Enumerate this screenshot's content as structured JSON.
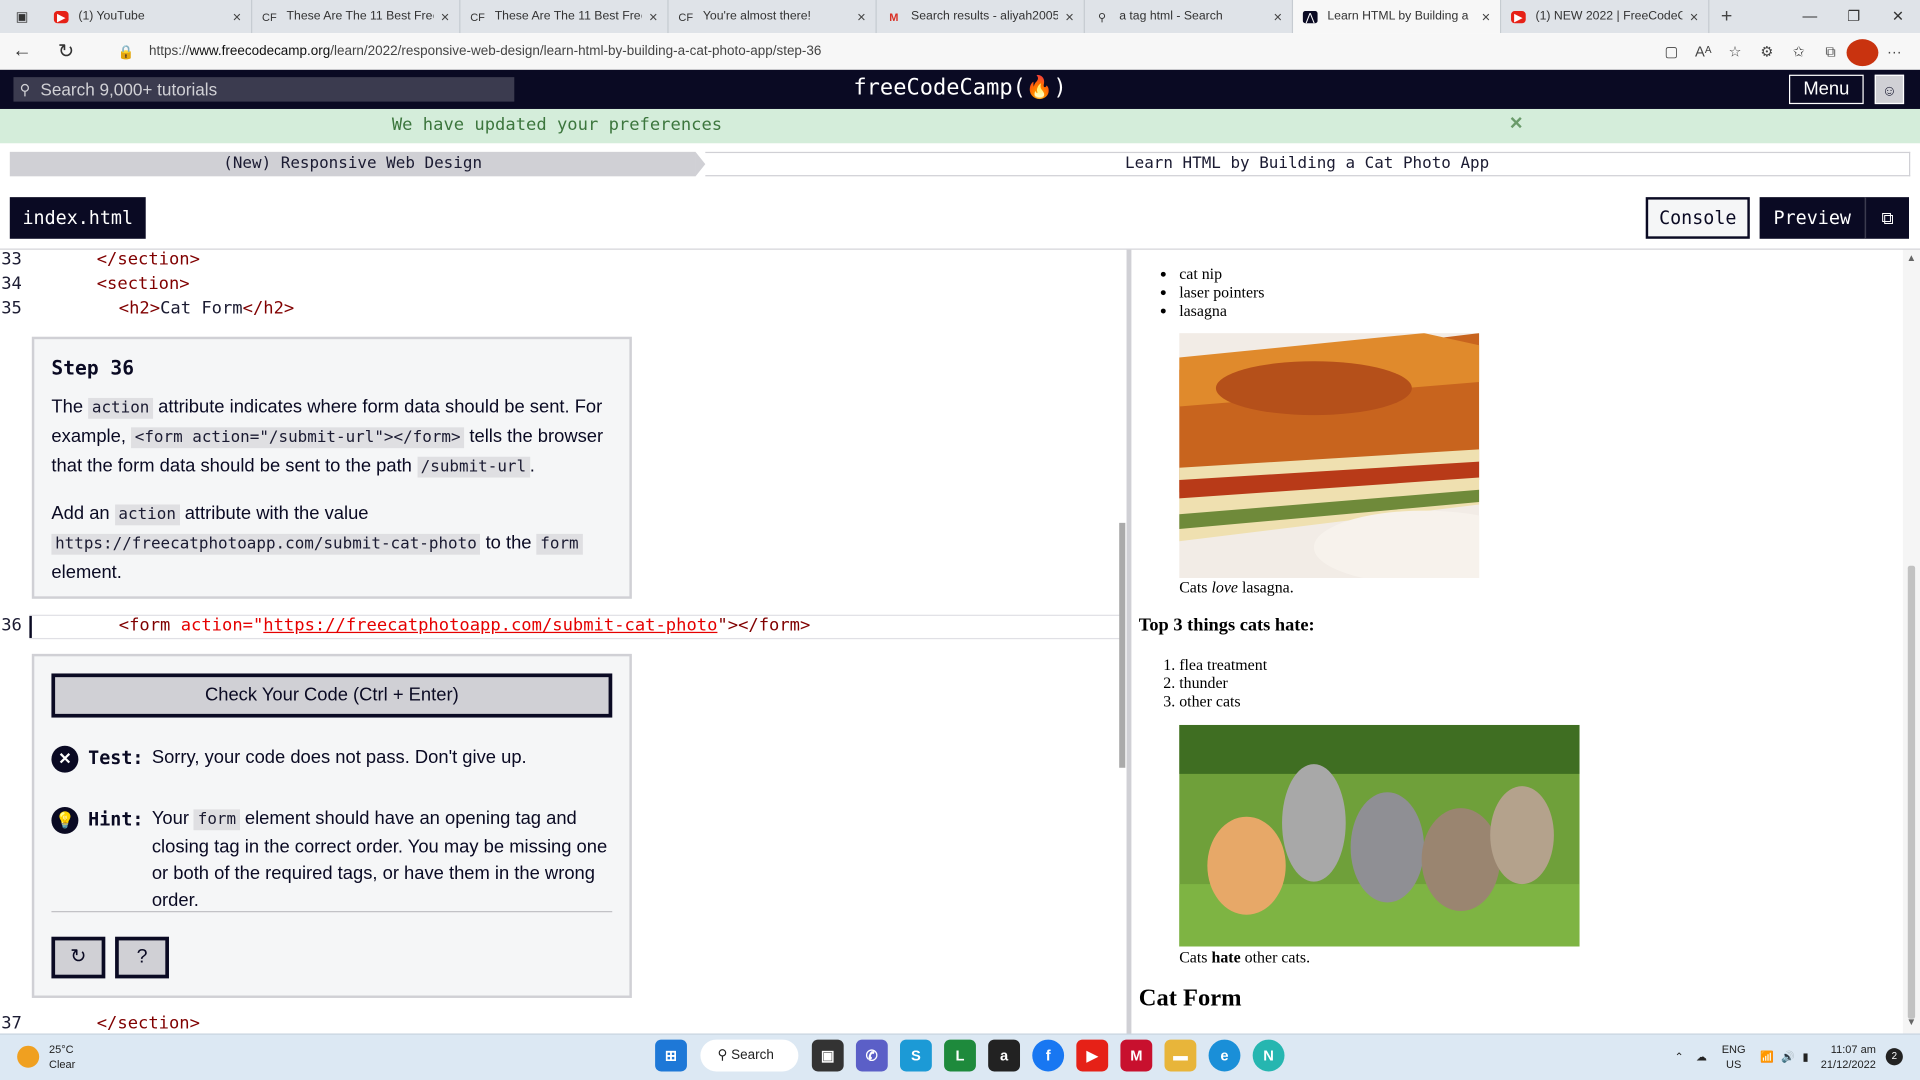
{
  "browser": {
    "tabs": [
      {
        "title": "(1) YouTube",
        "icon": "youtube-icon",
        "active": false
      },
      {
        "title": "These Are The 11 Best Free",
        "icon": "fcc-icon",
        "active": false
      },
      {
        "title": "These Are The 11 Best Free",
        "icon": "fcc-icon",
        "active": false
      },
      {
        "title": "You're almost there!",
        "icon": "fcc-icon",
        "active": false
      },
      {
        "title": "Search results - aliyah2005",
        "icon": "gmail-icon",
        "active": false
      },
      {
        "title": "a tag html - Search",
        "icon": "search-icon",
        "active": false
      },
      {
        "title": "Learn HTML by Building a",
        "icon": "fcc-icon",
        "active": true
      },
      {
        "title": "(1) NEW 2022 | FreeCodeC",
        "icon": "youtube-icon",
        "active": false
      }
    ],
    "url_prefix": "https://",
    "url_host": "www.freecodecamp.org",
    "url_path": "/learn/2022/responsive-web-design/learn-html-by-building-a-cat-photo-app/step-36"
  },
  "fcc": {
    "search_placeholder": "Search 9,000+ tutorials",
    "logo": "freeCodeCamp(🔥)",
    "menu_label": "Menu"
  },
  "flash": {
    "message": "We have updated your preferences",
    "close": "×"
  },
  "breadcrumb": {
    "superblock": "(New) Responsive Web Design",
    "block": "Learn HTML by Building a Cat Photo App"
  },
  "toolbar": {
    "file_tab": "index.html",
    "console": "Console",
    "preview": "Preview"
  },
  "editor": {
    "lines": [
      {
        "num": "33",
        "indent": "    ",
        "text": "</section>"
      },
      {
        "num": "34",
        "indent": "    ",
        "text": "<section>"
      },
      {
        "num": "35",
        "indent": "      ",
        "text": "<h2>Cat Form</h2>"
      },
      {
        "num": "36",
        "text": "<form action=\"https://freecatphotoapp.com/submit-cat-photo\"></form>"
      },
      {
        "num": "37",
        "indent": "    ",
        "text": "</section>"
      }
    ],
    "line36": {
      "open": "<form ",
      "attr": "action=\"",
      "url": "https://freecatphotoapp.com/submit-cat-photo",
      "close": "\"></form>"
    }
  },
  "step": {
    "title": "Step 36",
    "p1_a": "The ",
    "p1_code1": "action",
    "p1_b": " attribute indicates where form data should be sent. For example, ",
    "p1_code2": "<form action=\"/submit-url\"></form>",
    "p1_c": " tells the browser that the form data should be sent to the path ",
    "p1_code3": "/submit-url",
    "p1_d": ".",
    "p2_a": "Add an ",
    "p2_code1": "action",
    "p2_b": " attribute with the value ",
    "p2_code2": "https://freecatphotoapp.com/submit-cat-photo",
    "p2_c": " to the ",
    "p2_code3": "form",
    "p2_d": " element."
  },
  "tests": {
    "check_button": "Check Your Code (Ctrl + Enter)",
    "test_label": "Test:",
    "test_text": "Sorry, your code does not pass. Don't give up.",
    "hint_label": "Hint:",
    "hint_a": "Your ",
    "hint_code": "form",
    "hint_b": " element should have an opening tag and closing tag in the correct order. You may be missing one or both of the required tags, or have them in the wrong order."
  },
  "preview": {
    "likes_items": [
      "cat nip",
      "laser pointers",
      "lasagna"
    ],
    "lasagna_caption_a": "Cats ",
    "lasagna_caption_em": "love",
    "lasagna_caption_b": " lasagna.",
    "hate_heading": "Top 3 things cats hate:",
    "hate_items": [
      "flea treatment",
      "thunder",
      "other cats"
    ],
    "cats_caption_a": "Cats ",
    "cats_caption_strong": "hate",
    "cats_caption_b": " other cats.",
    "form_heading": "Cat Form"
  },
  "taskbar": {
    "temp": "25°C",
    "weather": "Clear",
    "search": "Search",
    "lang1": "ENG",
    "lang2": "US",
    "time": "11:07 am",
    "date": "21/12/2022",
    "notifications": "2"
  },
  "colors": {
    "fcc_dark": "#0a0a23",
    "flash_bg": "#d4edda",
    "flash_text": "#3c763d",
    "tag": "#800000",
    "attr": "#e50000"
  }
}
